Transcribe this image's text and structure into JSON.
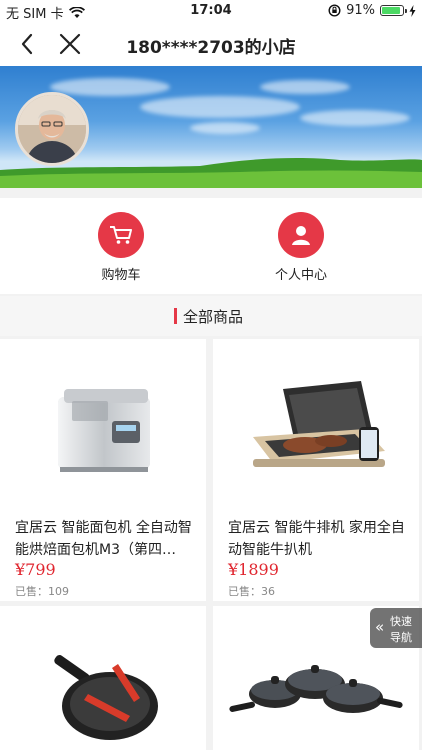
{
  "status_bar": {
    "carrier": "无 SIM 卡",
    "time": "17:04",
    "battery_percent": "91%",
    "battery_level": 0.91
  },
  "navbar": {
    "title": "180****2703的小店"
  },
  "quick_links": [
    {
      "label": "购物车",
      "icon": "cart-icon"
    },
    {
      "label": "个人中心",
      "icon": "person-icon"
    }
  ],
  "section": {
    "title": "全部商品"
  },
  "products": [
    {
      "name": "宜居云 智能面包机 全自动智能烘焙面包机M3（第四…",
      "price": "¥799",
      "sold": "已售：109",
      "image": "bread-maker"
    },
    {
      "name": "宜居云 智能牛排机 家用全自动智能牛扒机",
      "price": "¥1899",
      "sold": "已售：36",
      "image": "steak-grill"
    },
    {
      "name": "",
      "price": "",
      "sold": "",
      "image": "frying-pan"
    },
    {
      "name": "",
      "price": "",
      "sold": "",
      "image": "pot-set"
    }
  ],
  "quick_nav": {
    "line1": "快速",
    "line2": "导航"
  },
  "colors": {
    "accent": "#e53847",
    "price": "#e0262f"
  }
}
